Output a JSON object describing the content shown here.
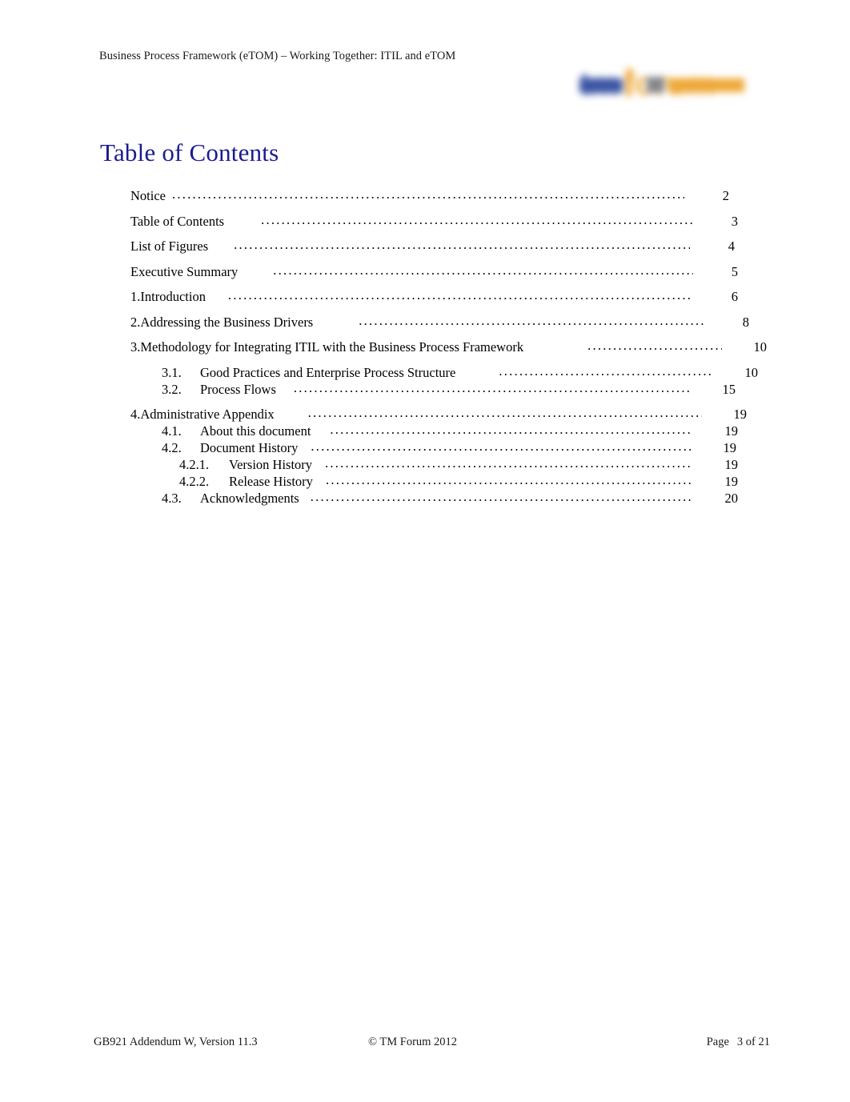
{
  "header": {
    "running_title": "Business Process Framework (eTOM) – Working Together: ITIL and eTOM",
    "logo": {
      "name": "tmforum-logo",
      "text_primary": "tm",
      "text_secondary": "forum",
      "color_primary": "#2e4a9e",
      "color_secondary": "#eda22a"
    }
  },
  "page_title": "Table of Contents",
  "title_color": "#1b1b8f",
  "toc": {
    "entries": [
      {
        "level": 1,
        "number": "",
        "label": "Notice",
        "page": "2",
        "gap": 6,
        "leader_end": 855
      },
      {
        "level": 1,
        "number": "",
        "label": "Table of Contents",
        "page": "3",
        "gap": 44,
        "leader_end": 866
      },
      {
        "level": 1,
        "number": "",
        "label": "List of Figures",
        "page": "4",
        "gap": 30,
        "leader_end": 862
      },
      {
        "level": 1,
        "number": "",
        "label": "Executive Summary",
        "page": "5",
        "gap": 42,
        "leader_end": 866
      },
      {
        "level": 1,
        "number": "1.",
        "label": "Introduction",
        "page": "6",
        "gap": 26,
        "leader_end": 866
      },
      {
        "level": 1,
        "number": "2.",
        "label": "Addressing the Business Drivers",
        "page": "8",
        "gap": 55,
        "leader_end": 880
      },
      {
        "level": 1,
        "number": "3.",
        "label": "Methodology for Integrating ITIL with the Business Process Framework",
        "page": "10",
        "gap": 78,
        "leader_end": 902
      },
      {
        "level": 2,
        "number": "3.1.",
        "label": "Good Practices and Enterprise Process Structure",
        "page": "10",
        "gap": 52,
        "leader_end": 891
      },
      {
        "level": 2,
        "number": "3.2.",
        "label": "Process Flows",
        "page": "15",
        "gap": 20,
        "leader_end": 863
      },
      {
        "level": 1,
        "number": "4.",
        "label": "Administrative Appendix",
        "page": "19",
        "gap": 40,
        "leader_end": 877
      },
      {
        "level": 2,
        "number": "4.1.",
        "label": "About this document",
        "page": "19",
        "gap": 22,
        "leader_end": 866
      },
      {
        "level": 2,
        "number": "4.2.",
        "label": "Document History",
        "page": "19",
        "gap": 14,
        "leader_end": 864
      },
      {
        "level": 3,
        "number": "4.2.1.",
        "label": "Version History",
        "page": "19",
        "gap": 14,
        "leader_end": 866
      },
      {
        "level": 3,
        "number": "4.2.2.",
        "label": "Release History",
        "page": "19",
        "gap": 14,
        "leader_end": 866
      },
      {
        "level": 2,
        "number": "4.3.",
        "label": "Acknowledgments",
        "page": "20",
        "gap": 12,
        "leader_end": 866
      }
    ]
  },
  "footer": {
    "left": "GB921 Addendum W, Version 11.3",
    "center": "© TM Forum 2012",
    "page_word": "Page",
    "page_value": "3 of 21"
  }
}
